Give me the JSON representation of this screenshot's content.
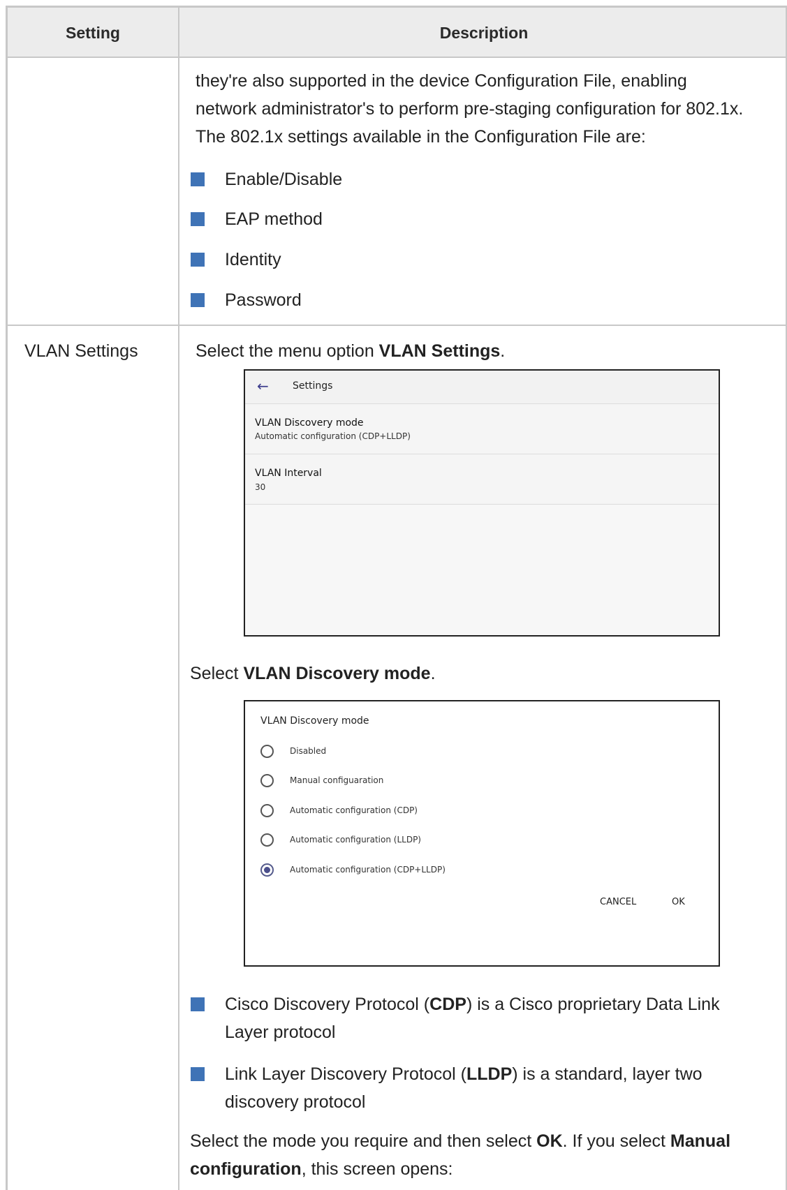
{
  "header": {
    "setting": "Setting",
    "description": "Description"
  },
  "row1": {
    "paragraph": "they're also supported in the device Configuration File, enabling network administrator's to perform pre-staging configuration for 802.1x. The 802.1x settings available in the Configuration File are:",
    "bullets": [
      "Enable/Disable",
      "EAP method",
      "Identity",
      "Password"
    ]
  },
  "row2": {
    "setting": "VLAN Settings",
    "step1_prefix": "Select the menu option ",
    "step1_bold": "VLAN Settings",
    "step1_suffix": ".",
    "shot1": {
      "title": "Settings",
      "items": [
        {
          "title": "VLAN Discovery mode",
          "value": "Automatic configuration (CDP+LLDP)"
        },
        {
          "title": "VLAN Interval",
          "value": "30"
        }
      ]
    },
    "step2_prefix": "Select ",
    "step2_bold": "VLAN Discovery mode",
    "step2_suffix": ".",
    "shot2": {
      "title": "VLAN Discovery mode",
      "options": [
        "Disabled",
        "Manual configuaration",
        "Automatic configuration (CDP)",
        "Automatic configuration (LLDP)",
        "Automatic configuration (CDP+LLDP)"
      ],
      "selected": "Automatic configuration (CDP+LLDP)",
      "cancel": "CANCEL",
      "ok": "OK"
    },
    "bullet_cdp": {
      "a": "Cisco Discovery Protocol (",
      "b": "CDP",
      "c": ") is a Cisco proprietary Data Link",
      "d": "Layer protocol"
    },
    "bullet_lldp": {
      "a": "Link Layer Discovery Protocol (",
      "b": "LLDP",
      "c": ") is a standard, layer two",
      "d": "discovery protocol"
    },
    "final": {
      "a": "Select the mode you require and then select ",
      "b": "OK",
      "c": ". If you select ",
      "d": "Manual",
      "e": "configuration",
      "f": ", this screen opens:"
    }
  }
}
